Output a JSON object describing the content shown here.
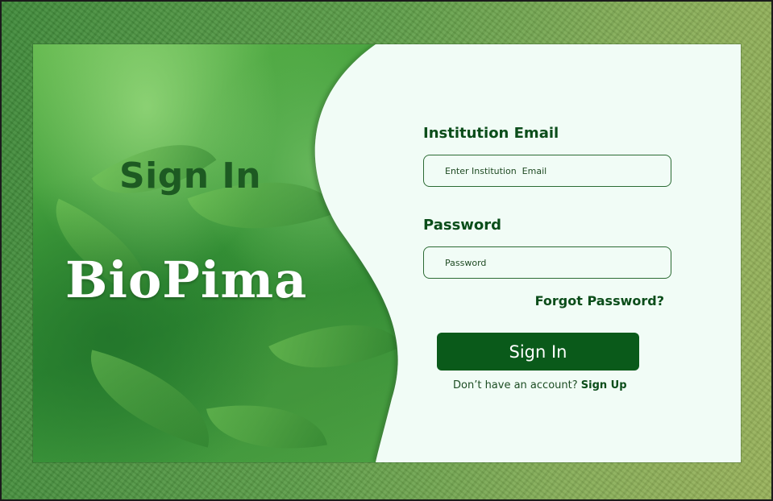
{
  "hero": {
    "heading": "Sign In",
    "brand": "BioPima"
  },
  "form": {
    "email_label": "Institution Email",
    "email_placeholder": "Enter Institution  Email",
    "email_value": "",
    "password_label": "Password",
    "password_placeholder": "Password",
    "password_value": "",
    "forgot_label": "Forgot Password?",
    "submit_label": "Sign In",
    "signup_prompt": "Don’t have an account?",
    "signup_link": "Sign Up"
  },
  "colors": {
    "primary": "#0a5a1a",
    "text_dark_green": "#0b4d1a",
    "card_background": "#f1fcf6",
    "frame_green": "#5c9d48"
  }
}
